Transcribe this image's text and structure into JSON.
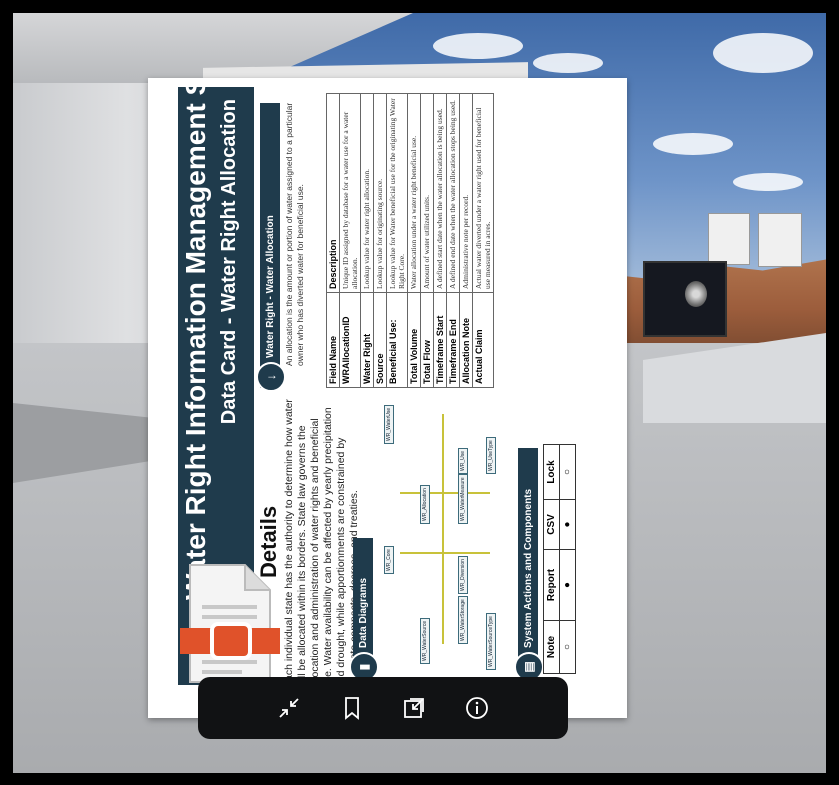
{
  "document": {
    "title": "Water Right Information Management System",
    "subtitle": "Data Card - Water Right Allocation",
    "details_heading": "Details",
    "details_text": "Each individual state has the authority to determine how water will be allocated within its borders. State law governs the allocation and administration of water rights and beneficial use. Water availability can be affected by yearly precipitation and drought, while apportionments are constrained by interstate compacts, decrees, and treaties.",
    "allocation_section": {
      "heading": "Water Right - Water Allocation",
      "description": "An allocation is the amount or portion of water assigned to a particular owner who has diverted water for beneficial use."
    },
    "field_table": {
      "headers": [
        "Field Name",
        "Description"
      ],
      "rows": [
        {
          "name": "WRAllocationID",
          "desc": "Unique ID assigned by database for a water use for a water allocation."
        },
        {
          "name": "Water Right",
          "desc": "Lookup value for water right allocation."
        },
        {
          "name": "Source",
          "desc": "Lookup value for originating source."
        },
        {
          "name": "Beneficial Use:",
          "desc": "Lookup value for Water beneficial use for the originating Water Right Core."
        },
        {
          "name": "Total Volume",
          "desc": "Water allocation under a water right beneficial use."
        },
        {
          "name": "Total Flow",
          "desc": "Amount of water utilized units."
        },
        {
          "name": "Timeframe Start",
          "desc": "A defined start date when the water allocation is being used."
        },
        {
          "name": "Timeframe End",
          "desc": "A defined end date when the water allocation stops being used."
        },
        {
          "name": "Allocation Note",
          "desc": "Administrative note per record."
        },
        {
          "name": "Actual Claim",
          "desc": "Actual water diverted under a water right used for beneficial use measured in acres."
        }
      ]
    },
    "diagrams_section": {
      "heading": "Data Diagrams"
    },
    "diagram_nodes": [
      "WR_Core",
      "WR_Allocation",
      "WR_WaterSource",
      "WR_Diversion",
      "WR_WaterStorage",
      "WR_Use",
      "WR_UseType",
      "WR_WaterUse",
      "WR_WaterSourceType",
      "WR_WaterMeasure"
    ],
    "actions_section": {
      "heading": "System Actions and Components",
      "headers": [
        "Note",
        "Report",
        "CSV",
        "Lock"
      ],
      "row": [
        "○",
        "●",
        "●",
        "○"
      ]
    }
  },
  "toolbar": {
    "buttons": [
      {
        "name": "collapse-button",
        "icon": "collapse-arrows-icon"
      },
      {
        "name": "bookmark-button",
        "icon": "bookmark-icon"
      },
      {
        "name": "open-external-button",
        "icon": "open-external-icon"
      },
      {
        "name": "info-button",
        "icon": "info-icon"
      }
    ]
  },
  "colors": {
    "title_bar": "#1f3b4c",
    "toolbar_bg": "#111214",
    "file_icon_accent": "#e0522a"
  }
}
